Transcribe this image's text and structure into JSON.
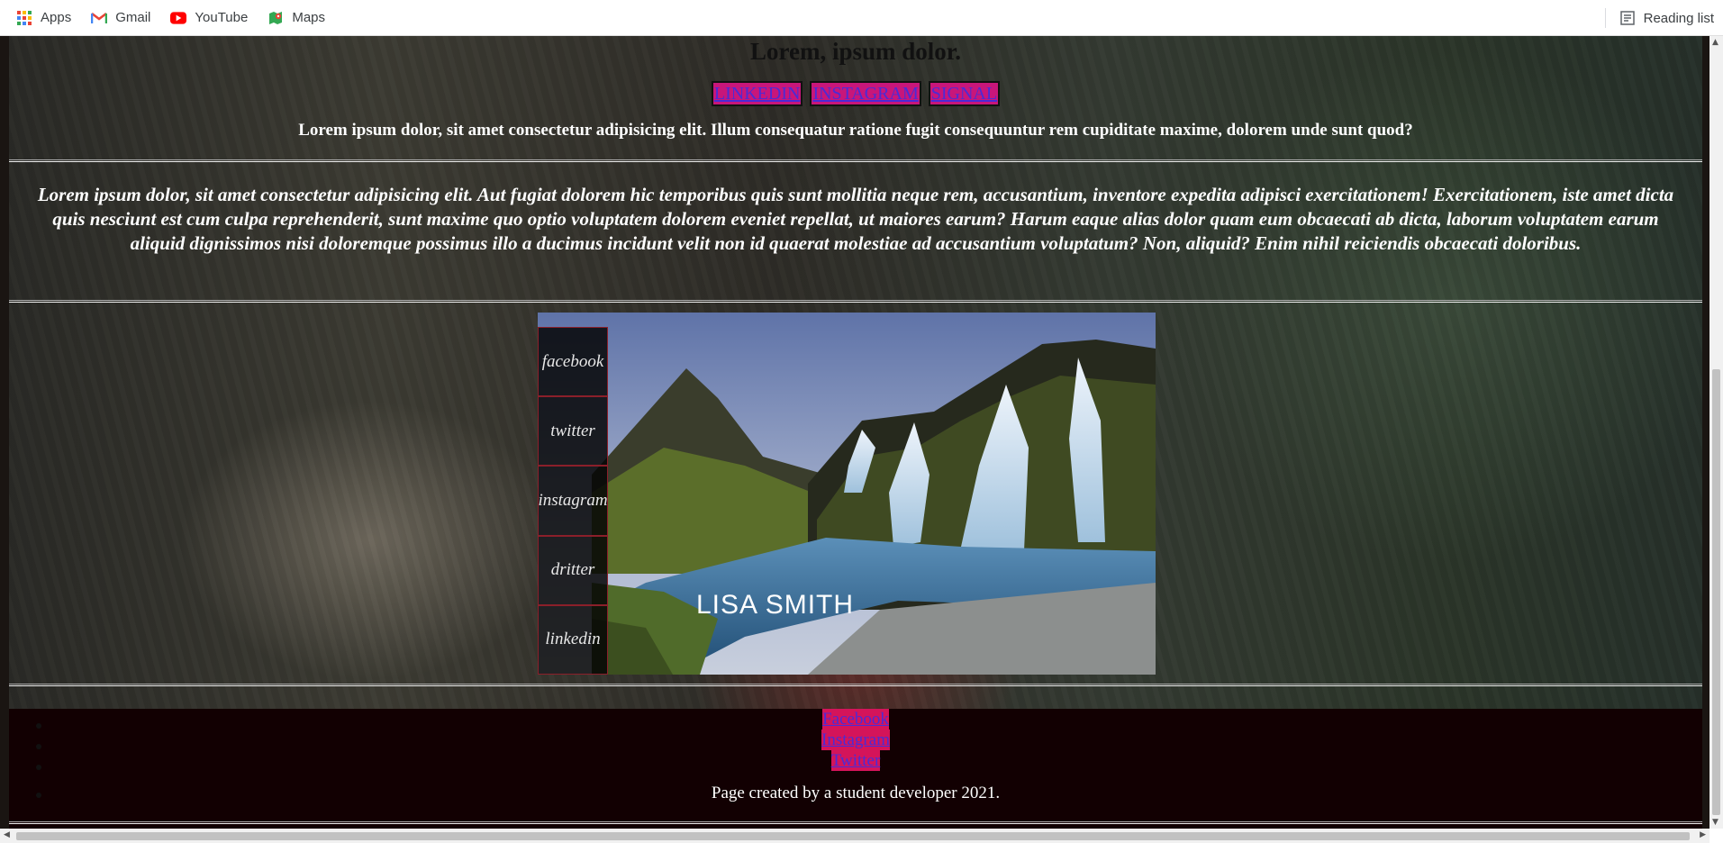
{
  "browser": {
    "bookmarks": [
      {
        "label": "Apps",
        "icon": "apps-grid-icon"
      },
      {
        "label": "Gmail",
        "icon": "gmail-icon"
      },
      {
        "label": "YouTube",
        "icon": "youtube-icon"
      },
      {
        "label": "Maps",
        "icon": "maps-icon"
      }
    ],
    "reading_list": "Reading list"
  },
  "page": {
    "title": "Lorem, ipsum dolor.",
    "nav_links": [
      "LINKEDIN",
      "INSTAGRAM",
      "SIGNAL"
    ],
    "lead": "Lorem ipsum dolor, sit amet consectetur adipisicing elit. Illum consequatur ratione fugit consequuntur rem cupiditate maxime, dolorem unde sunt quod?",
    "paragraph": "Lorem ipsum dolor, sit amet consectetur adipisicing elit. Aut fugiat dolorem hic temporibus quis sunt mollitia neque rem, accusantium, inventore expedita adipisci exercitationem! Exercitationem, iste amet dicta quis nesciunt est cum culpa reprehenderit, sunt maxime quo optio voluptatem dolorem eveniet repellat, ut maiores earum? Harum eaque alias dolor quam eum obcaecati ab dicta, laborum voluptatem earum aliquid dignissimos nisi doloremque possimus illo a ducimus incidunt velit non id quaerat molestiae ad accusantium voluptatum? Non, aliquid? Enim nihil reiciendis obcaecati doloribus.",
    "card": {
      "social": [
        "facebook",
        "twitter",
        "instagram",
        "dritter",
        "linkedin"
      ],
      "name": "LISA SMITH"
    },
    "footer": {
      "links": [
        "Facebook",
        "Instagram",
        "Twitter"
      ],
      "credit": "Page created by a student developer 2021."
    }
  },
  "colors": {
    "link_bg": "#c8167a",
    "link_text": "#4b2bd6",
    "footer_bg": "#120002",
    "card_border": "#8b1f2a"
  }
}
